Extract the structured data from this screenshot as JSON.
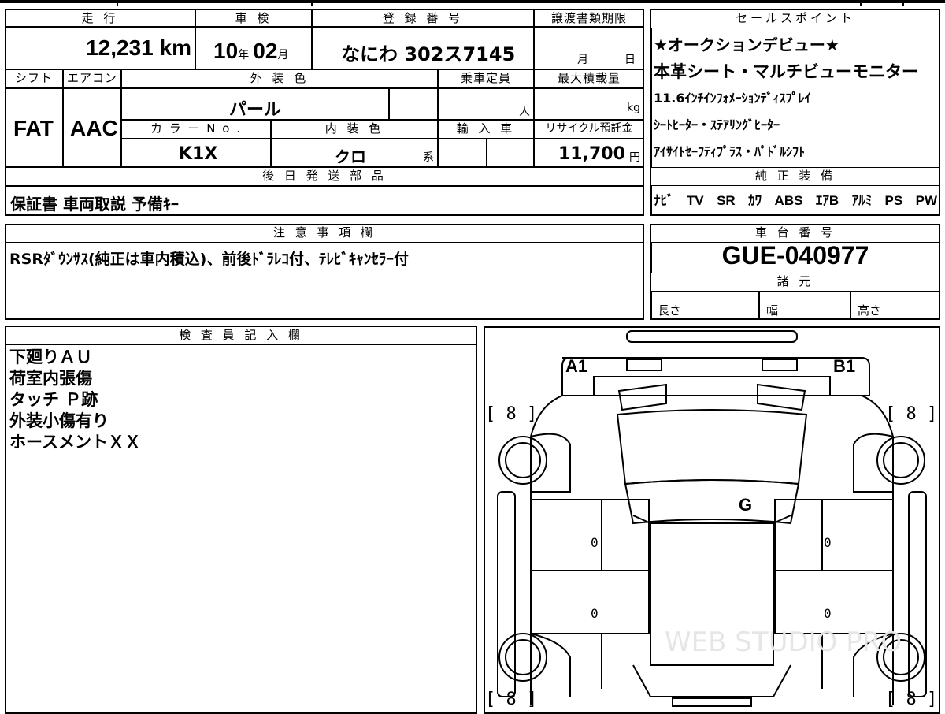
{
  "header": {
    "mileage_label": "走 行",
    "mileage_value": "12,231 km",
    "inspection_label": "車 検",
    "inspection_year": "10",
    "inspection_year_unit": "年",
    "inspection_month": "02",
    "inspection_month_unit": "月",
    "registration_label": "登 録 番 号",
    "registration_value": "なにわ 302ス7145",
    "transfer_deadline_label": "譲渡書類期限",
    "transfer_month_unit": "月",
    "transfer_day_unit": "日"
  },
  "specs": {
    "shift_label": "シフト",
    "shift_value": "FAT",
    "aircon_label": "エアコン",
    "aircon_value": "AAC",
    "exterior_color_label": "外 装 色",
    "exterior_color_value": "パール",
    "capacity_label": "乗車定員",
    "capacity_unit": "人",
    "max_load_label": "最大積載量",
    "max_load_unit": "kg",
    "color_no_label": "カ ラ ー N o .",
    "color_no_value": "K1X",
    "interior_color_label": "内 装 色",
    "interior_color_value": "クロ",
    "interior_color_suffix": "系",
    "import_label": "輸 入 車",
    "recycle_label": "リサイクル預託金",
    "recycle_value": "11,700",
    "recycle_unit": "円"
  },
  "later_shipping": {
    "label": "後 日 発 送 部 品",
    "value": "保証書 車両取説 予備ｷｰ"
  },
  "sales_points": {
    "label": "セールスポイント",
    "lines": [
      "★オークションデビュー★",
      "本革シート・マルチビューモニター",
      "11.6ｲﾝﾁｲﾝﾌｫﾒｰｼｮﾝﾃﾞｨｽﾌﾟﾚｲ",
      "ｼｰﾄﾋｰﾀｰ・ｽﾃｱﾘﾝｸﾞﾋｰﾀｰ",
      "ｱｲｻｲﾄｾｰﾌﾃｨﾌﾟﾗｽ・ﾊﾟﾄﾞﾙｼﾌﾄ"
    ]
  },
  "equipment": {
    "label": "純 正 装 備",
    "items": [
      "ﾅﾋﾞ",
      "TV",
      "SR",
      "ｶﾜ",
      "ABS",
      "ｴｱB",
      "ｱﾙﾐ",
      "PS",
      "PW"
    ]
  },
  "notes": {
    "label": "注 意 事 項 欄",
    "value": "RSRﾀﾞｳﾝｻｽ(純正は車内積込)、前後ﾄﾞﾗﾚｺ付、ﾃﾚﾋﾞｷｬﾝｾﾗｰ付"
  },
  "chassis": {
    "label": "車 台 番 号",
    "value": "GUE-040977"
  },
  "dimensions": {
    "label": "諸 元",
    "length_label": "長さ",
    "width_label": "幅",
    "height_label": "高さ"
  },
  "inspector": {
    "label": "検 査 員 記 入 欄",
    "lines": [
      "下廻りＡＵ",
      "荷室内張傷",
      "タッチ Ｐ跡",
      "外装小傷有り",
      "ホースメントＸＸ"
    ]
  },
  "diagram": {
    "mark_a1": "A1",
    "mark_b1": "B1",
    "mark_g": "G",
    "tire_tl": "[ 8 ]",
    "tire_tr": "[ 8 ]",
    "tire_bl": "[ 8 ]",
    "tire_br": "[ 8 ]",
    "door_l1": "0",
    "door_l2": "0",
    "door_r1": "0",
    "door_r2": "0",
    "watermark": "WEB STUDIO PRO"
  }
}
